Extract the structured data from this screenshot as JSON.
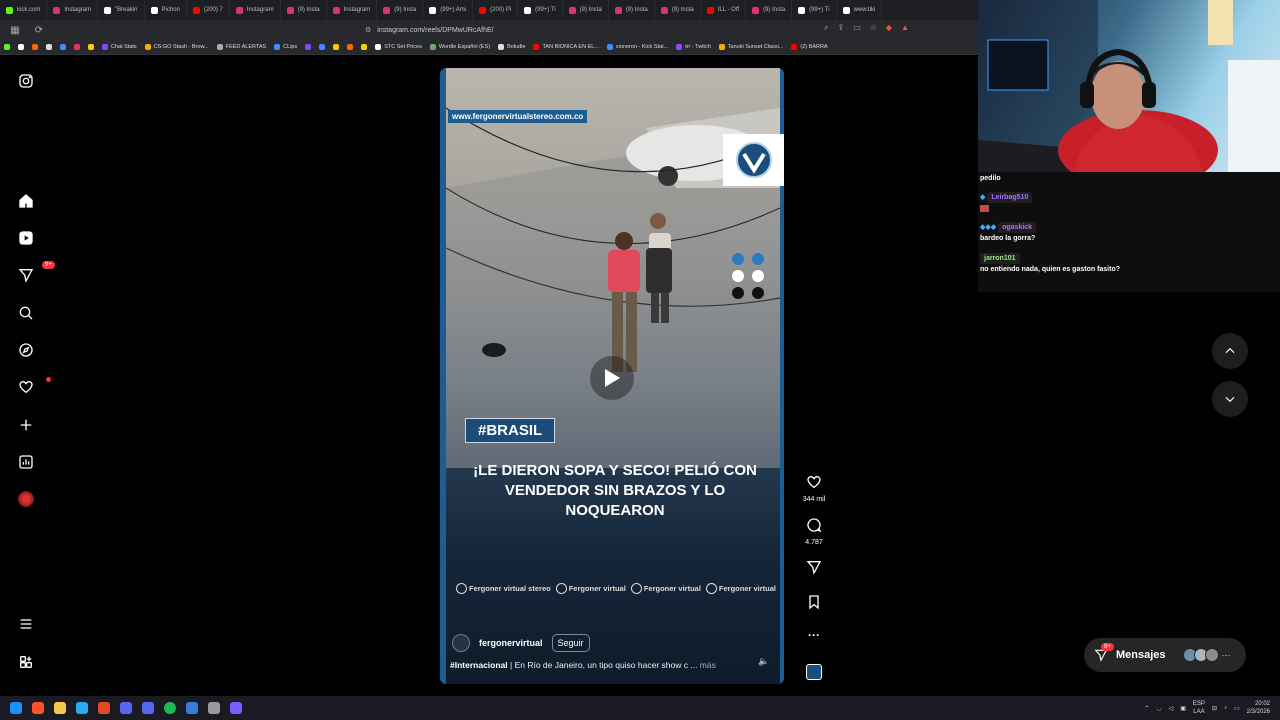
{
  "browser": {
    "tabs": [
      {
        "label": "kick.com",
        "color": "#53fc18"
      },
      {
        "label": "Instagram",
        "color": "#e1306c"
      },
      {
        "label": "\"Breakin",
        "color": "#ffffff"
      },
      {
        "label": "Pichon",
        "color": "#ffffff"
      },
      {
        "label": "(200) 7",
        "color": "#ff0000"
      },
      {
        "label": "Instagram",
        "color": "#e1306c"
      },
      {
        "label": "(9) Insta",
        "color": "#e1306c"
      },
      {
        "label": "Instagram",
        "color": "#e1306c"
      },
      {
        "label": "(9) Insta",
        "color": "#e1306c"
      },
      {
        "label": "(99+) Ami",
        "color": "#ffffff"
      },
      {
        "label": "(200) Pi",
        "color": "#ff0000"
      },
      {
        "label": "(99+) Ti",
        "color": "#ffffff"
      },
      {
        "label": "(9) Insta",
        "color": "#e1306c"
      },
      {
        "label": "(9) Insta",
        "color": "#e1306c"
      },
      {
        "label": "(9) Insta",
        "color": "#e1306c"
      },
      {
        "label": "ILL - Off",
        "color": "#ff0000"
      },
      {
        "label": "(9) Insta",
        "color": "#e1306c"
      },
      {
        "label": "(99+) Ti",
        "color": "#ffffff"
      },
      {
        "label": "www.tiki",
        "color": "#ffffff"
      }
    ],
    "url": "instagram.com/reels/DPMwURcAfhE/",
    "bookmarks": [
      {
        "label": "",
        "color": "#53fc18"
      },
      {
        "label": "",
        "color": "#ffffff"
      },
      {
        "label": "",
        "color": "#ff6600"
      },
      {
        "label": "",
        "color": "#dddddd"
      },
      {
        "label": "",
        "color": "#4488ff"
      },
      {
        "label": "",
        "color": "#e1306c"
      },
      {
        "label": "",
        "color": "#ffcc00"
      },
      {
        "label": "Chat Stats",
        "color": "#8844ff"
      },
      {
        "label": "CS:GO Stash - Brow...",
        "color": "#ffaa00"
      },
      {
        "label": "FEED ALERTAS",
        "color": "#aaaaaa"
      },
      {
        "label": "CLips",
        "color": "#4488ff"
      },
      {
        "label": "",
        "color": "#8844ff"
      },
      {
        "label": "",
        "color": "#4488ff"
      },
      {
        "label": "",
        "color": "#ffcc00"
      },
      {
        "label": "",
        "color": "#ff6600"
      },
      {
        "label": "",
        "color": "#ffcc00"
      },
      {
        "label": "STC Set Prices",
        "color": "#ffffff"
      },
      {
        "label": "Wordle Español (ES)",
        "color": "#6aaa64"
      },
      {
        "label": "Boludle",
        "color": "#dddddd"
      },
      {
        "label": "TAN BIONICA EN EL...",
        "color": "#ff0000"
      },
      {
        "label": "sioneron - Kick Stat...",
        "color": "#4488ff"
      },
      {
        "label": "trr - Twitch",
        "color": "#9146ff"
      },
      {
        "label": "Tanuki Sunset Classi...",
        "color": "#ffaa00"
      },
      {
        "label": "(2) BARRA",
        "color": "#ff0000"
      }
    ]
  },
  "instagram": {
    "sidebar_badge": "9+",
    "reel": {
      "watermark_url": "www.fergonervirtualstereo.com.co",
      "hashtag_box": "#BRASIL",
      "headline": "¡LE DIERON SOPA Y SECO! PELIÓ CON VENDEDOR SIN BRAZOS Y LO NOQUEARON",
      "socials": [
        {
          "icon": "facebook-icon",
          "label": "Fergoner virtual stereo"
        },
        {
          "icon": "instagram-icon",
          "label": "Fergoner virtual"
        },
        {
          "icon": "tiktok-icon",
          "label": "Fergoner virtual"
        },
        {
          "icon": "youtube-icon",
          "label": "Fergoner virtual"
        }
      ],
      "author": "fergonervirtual",
      "follow_label": "Seguir",
      "caption_tag": "#Internacional",
      "caption_text": " | En Río de Janeiro, un tipo quiso hacer show c ...",
      "caption_more": " más"
    },
    "actions": {
      "likes": "344 mil",
      "comments": "4.787"
    },
    "messages": {
      "label": "Mensajes",
      "badge": "9+"
    }
  },
  "chat": {
    "messages": [
      {
        "user": "",
        "text": "pedilo",
        "user_color": "#ffffff"
      },
      {
        "user": "Leirbag510",
        "text": "",
        "user_color": "#a970ff"
      },
      {
        "user": "ogaskick",
        "text": "bardeo la gorra?",
        "user_color": "#b96cff"
      },
      {
        "user": "jarron101",
        "text": "no entiendo nada, quien es gaston fasito?",
        "user_color": "#9ee38f"
      }
    ]
  },
  "taskbar": {
    "lang": "ESP",
    "lang_sub": "LAA",
    "time": "20:02",
    "date": "2/3/2026"
  }
}
